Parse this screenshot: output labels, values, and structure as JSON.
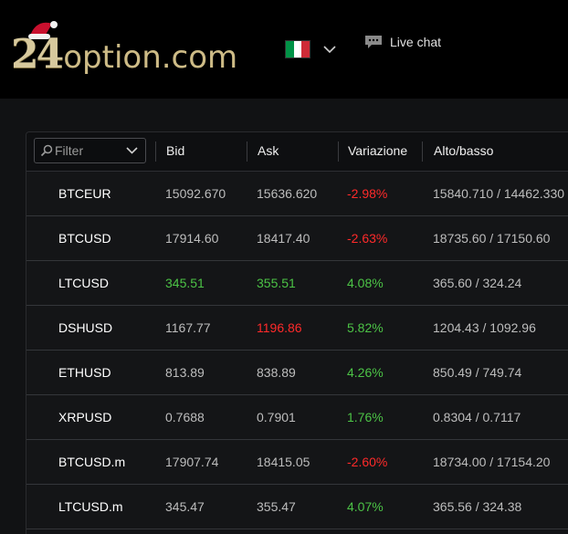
{
  "header": {
    "logo_number": "24",
    "logo_word": "option.com",
    "language_flag": "it-flag",
    "live_chat_label": "Live chat"
  },
  "filter": {
    "placeholder": "Filter"
  },
  "columns": {
    "bid": "Bid",
    "ask": "Ask",
    "change": "Variazione",
    "high_low": "Alto/basso"
  },
  "colors": {
    "positive": "#4cc346",
    "negative": "#ff2a2a",
    "neutral": "#bdbdbd",
    "logo_gold": "#d7c99d"
  },
  "rows": [
    {
      "symbol": "BTCEUR",
      "bid": "15092.670",
      "ask": "15636.620",
      "change": "-2.98%",
      "high_low": "15840.710 / 14462.330",
      "bid_tone": "neu",
      "ask_tone": "neu",
      "change_tone": "neg"
    },
    {
      "symbol": "BTCUSD",
      "bid": "17914.60",
      "ask": "18417.40",
      "change": "-2.63%",
      "high_low": "18735.60 / 17150.60",
      "bid_tone": "neu",
      "ask_tone": "neu",
      "change_tone": "neg"
    },
    {
      "symbol": "LTCUSD",
      "bid": "345.51",
      "ask": "355.51",
      "change": "4.08%",
      "high_low": "365.60 / 324.24",
      "bid_tone": "pos",
      "ask_tone": "pos",
      "change_tone": "pos"
    },
    {
      "symbol": "DSHUSD",
      "bid": "1167.77",
      "ask": "1196.86",
      "change": "5.82%",
      "high_low": "1204.43 / 1092.96",
      "bid_tone": "neu",
      "ask_tone": "neg",
      "change_tone": "pos"
    },
    {
      "symbol": "ETHUSD",
      "bid": "813.89",
      "ask": "838.89",
      "change": "4.26%",
      "high_low": "850.49 / 749.74",
      "bid_tone": "neu",
      "ask_tone": "neu",
      "change_tone": "pos"
    },
    {
      "symbol": "XRPUSD",
      "bid": "0.7688",
      "ask": "0.7901",
      "change": "1.76%",
      "high_low": "0.8304 / 0.7117",
      "bid_tone": "neu",
      "ask_tone": "neu",
      "change_tone": "pos"
    },
    {
      "symbol": "BTCUSD.m",
      "bid": "17907.74",
      "ask": "18415.05",
      "change": "-2.60%",
      "high_low": "18734.00 / 17154.20",
      "bid_tone": "neu",
      "ask_tone": "neu",
      "change_tone": "neg"
    },
    {
      "symbol": "LTCUSD.m",
      "bid": "345.47",
      "ask": "355.47",
      "change": "4.07%",
      "high_low": "365.56 / 324.38",
      "bid_tone": "neu",
      "ask_tone": "neu",
      "change_tone": "pos"
    }
  ]
}
